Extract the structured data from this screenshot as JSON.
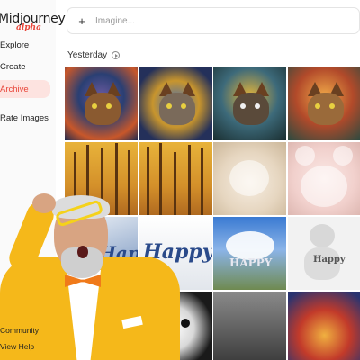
{
  "app": {
    "logo_main": "Midjourney",
    "logo_sub": "alpha"
  },
  "sidebar": {
    "items": [
      {
        "label": "Explore",
        "active": false
      },
      {
        "label": "Create",
        "active": false
      },
      {
        "label": "Archive",
        "active": true
      },
      {
        "label": "Rate Images",
        "active": false
      }
    ],
    "bottom": [
      {
        "label": "Community"
      },
      {
        "label": "View Help"
      }
    ]
  },
  "search": {
    "placeholder": "Imagine..."
  },
  "section": {
    "title": "Yesterday"
  },
  "colors": {
    "accent": "#e8463a",
    "active_bg": "#fde3e0"
  },
  "gallery": {
    "row1": [
      "cat painting",
      "cat painting",
      "cat painting",
      "cat painting"
    ],
    "row3_text": [
      "Happy",
      "Happy",
      "HAPPY",
      "Happy"
    ]
  }
}
